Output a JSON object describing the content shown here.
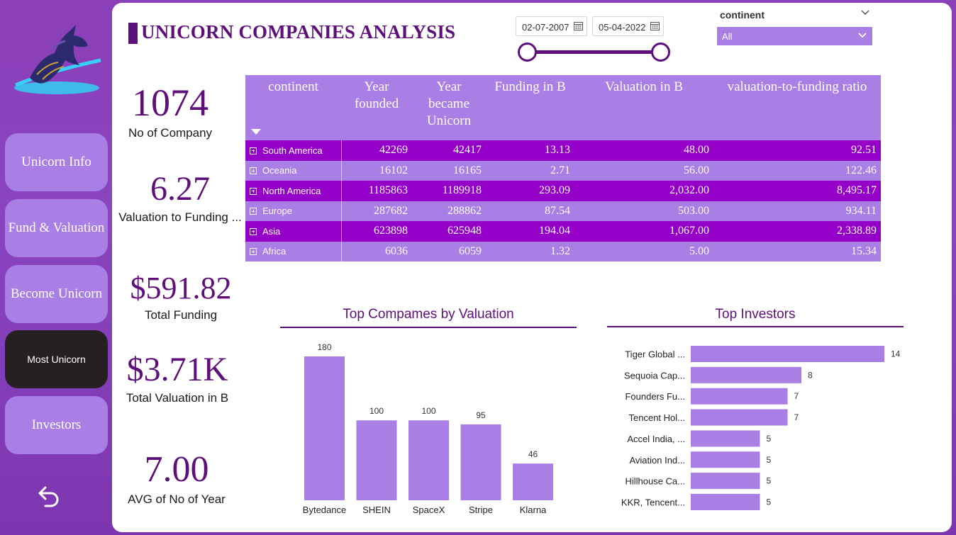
{
  "title": "UNICORN COMPANIES ANALYSIS",
  "colors": {
    "accent": "#5f0f7a",
    "bar": "#a97ee5",
    "row_dark": "#9500c9",
    "row_light": "#a97ee5",
    "sidebar": "#8b3fb8"
  },
  "logo": "unicorn-logo",
  "nav": {
    "items": [
      "Unicorn Info",
      "Fund & Valuation",
      "Become Unicorn",
      "Most Unicorn",
      "Investors"
    ],
    "active": "Most Unicorn",
    "back_icon": "back-arrow-icon"
  },
  "date_filter": {
    "start": "02-07-2007",
    "end": "05-04-2022"
  },
  "continent_filter": {
    "label": "continent",
    "value": "All"
  },
  "kpis": [
    {
      "value": "1074",
      "label": "No of Company"
    },
    {
      "value": "6.27",
      "label": "Valuation to Funding ..."
    },
    {
      "value": "$591.82",
      "label": "Total Funding"
    },
    {
      "value": "$3.71K",
      "label": "Total Valuation in B"
    },
    {
      "value": "7.00",
      "label": "AVG of No of Year"
    }
  ],
  "table": {
    "headers": [
      "continent",
      "Year founded",
      "Year became Unicorn",
      "Funding in B",
      "Valuation in B",
      "valuation-to-funding ratio"
    ],
    "rows": [
      [
        "South America",
        "42269",
        "42417",
        "13.13",
        "48.00",
        "92.51"
      ],
      [
        "Oceania",
        "16102",
        "16165",
        "2.71",
        "56.00",
        "122.46"
      ],
      [
        "North America",
        "1185863",
        "1189918",
        "293.09",
        "2,032.00",
        "8,495.17"
      ],
      [
        "Europe",
        "287682",
        "288862",
        "87.54",
        "503.00",
        "934.11"
      ],
      [
        "Asia",
        "623898",
        "625948",
        "194.04",
        "1,067.00",
        "2,338.89"
      ],
      [
        "Africa",
        "6036",
        "6059",
        "1.32",
        "5.00",
        "15.34"
      ]
    ]
  },
  "chart_data": [
    {
      "type": "bar",
      "title": "Top Compames by Valuation",
      "categories": [
        "Bytedance",
        "SHEIN",
        "SpaceX",
        "Stripe",
        "Klarna"
      ],
      "values": [
        180,
        100,
        100,
        95,
        46
      ],
      "data_labels": true,
      "grid": false
    },
    {
      "type": "bar",
      "orientation": "horizontal",
      "title": "Top Investors",
      "categories": [
        "Tiger Global ...",
        "Sequoia Cap...",
        "Founders Fu...",
        "Tencent Hol...",
        "Accel India, ...",
        "Aviation Ind...",
        "Hillhouse Ca...",
        "KKR, Tencent..."
      ],
      "values": [
        14,
        8,
        7,
        7,
        5,
        5,
        5,
        5
      ],
      "data_labels": true,
      "grid": false
    }
  ]
}
